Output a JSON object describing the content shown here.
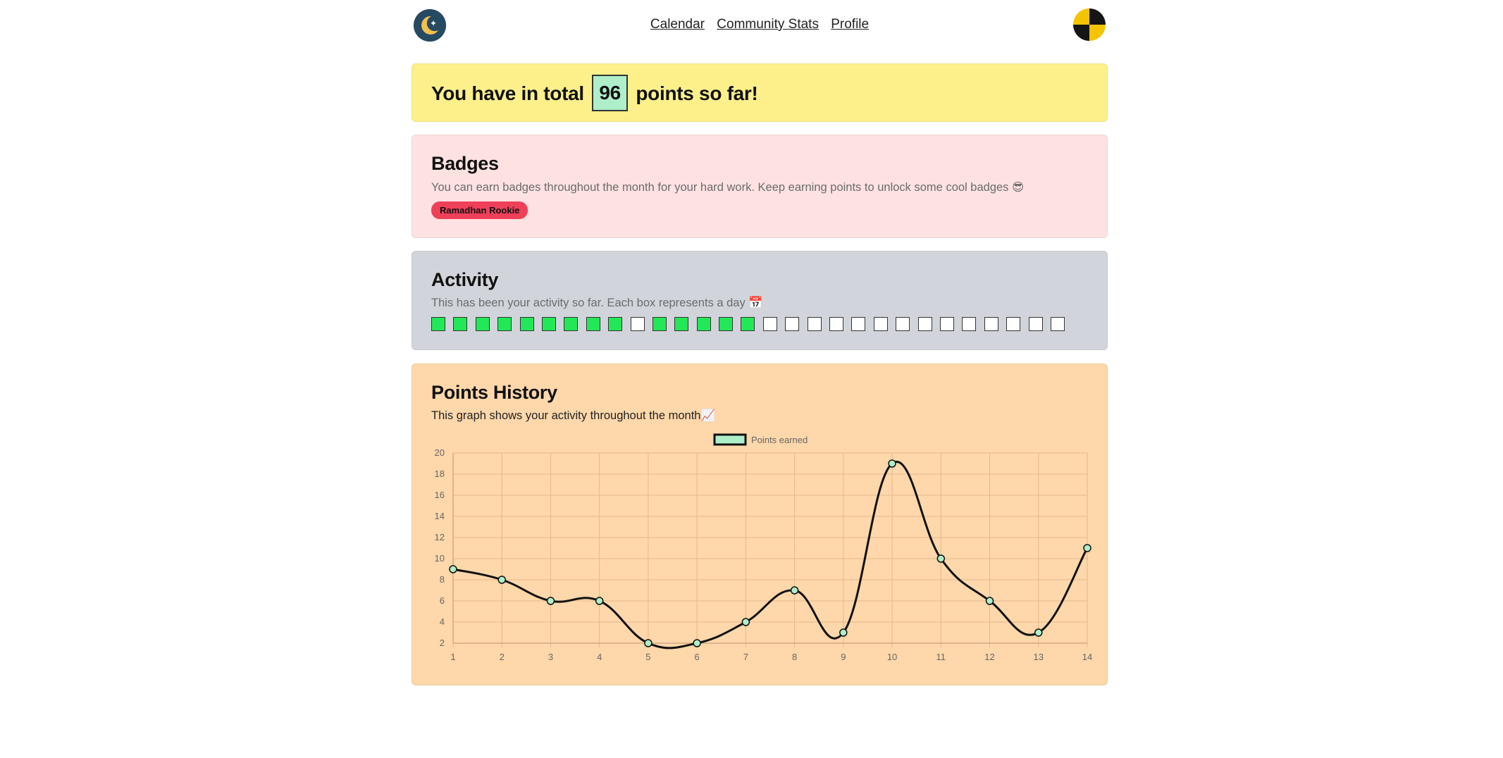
{
  "nav": {
    "items": [
      "Calendar",
      "Community Stats",
      "Profile"
    ]
  },
  "points": {
    "prefix": "You have in total",
    "value": "96",
    "suffix": "points so far!"
  },
  "badges": {
    "title": "Badges",
    "description": "You can earn badges throughout the month for your hard work. Keep earning points to unlock some cool badges 😎",
    "items": [
      "Ramadhan Rookie"
    ]
  },
  "activity": {
    "title": "Activity",
    "description": "This has been your activity so far. Each box represents a day 📅",
    "days": [
      1,
      1,
      1,
      1,
      1,
      1,
      1,
      1,
      1,
      0,
      1,
      1,
      1,
      1,
      1,
      0,
      0,
      0,
      0,
      0,
      0,
      0,
      0,
      0,
      0,
      0,
      0,
      0,
      0
    ]
  },
  "history": {
    "title": "Points History",
    "description": "This graph shows your activity throughout the month📈"
  },
  "colors": {
    "accent": "#aeefc9",
    "active_day": "#22e857",
    "badge": "#ef405a"
  },
  "chart_data": {
    "type": "line",
    "legend": [
      "Points earned"
    ],
    "legend_position": "top-center",
    "grid": true,
    "x": [
      1,
      2,
      3,
      4,
      5,
      6,
      7,
      8,
      9,
      10,
      11,
      12,
      13,
      14
    ],
    "series": [
      {
        "name": "Points earned",
        "values": [
          9,
          8,
          6,
          6,
          2,
          2,
          4,
          7,
          3,
          19,
          10,
          6,
          3,
          11
        ]
      }
    ],
    "ylim": [
      2,
      20
    ],
    "yticks": [
      2,
      4,
      6,
      8,
      10,
      12,
      14,
      16,
      18,
      20
    ]
  }
}
